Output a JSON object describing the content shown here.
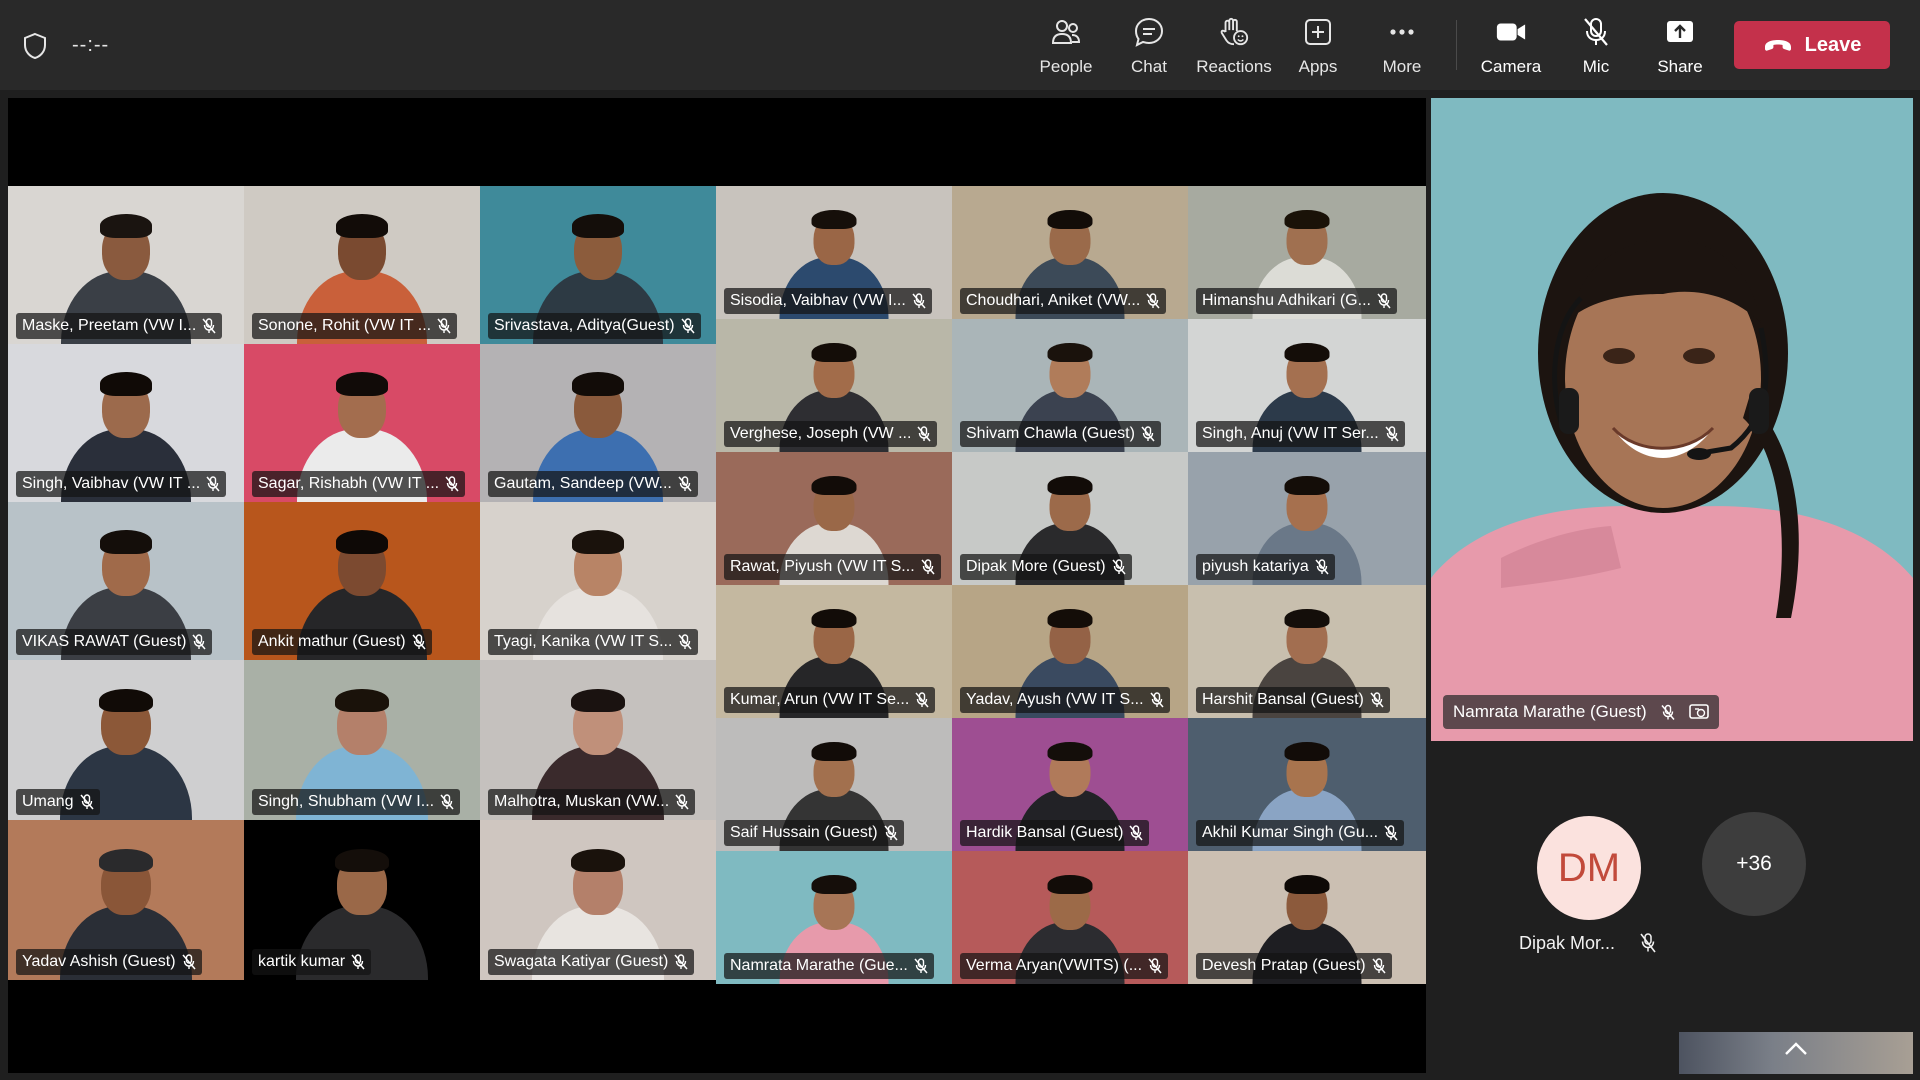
{
  "topbar": {
    "timer": "--:--",
    "buttons": [
      {
        "label": "People",
        "icon": "people-icon"
      },
      {
        "label": "Chat",
        "icon": "chat-icon"
      },
      {
        "label": "Reactions",
        "icon": "reactions-icon"
      },
      {
        "label": "Apps",
        "icon": "apps-icon"
      },
      {
        "label": "More",
        "icon": "more-icon"
      },
      {
        "label": "Camera",
        "icon": "camera-icon"
      },
      {
        "label": "Mic",
        "icon": "mic-off-icon"
      },
      {
        "label": "Share",
        "icon": "share-icon"
      }
    ],
    "leave_label": "Leave",
    "leave_color": "#c4314b"
  },
  "grid": {
    "participants": [
      {
        "name": "Maske, Preetam (VW I...",
        "bg": "#d9d6d2",
        "skin": "#8a5a3e",
        "shirt": "#3a3f46",
        "hair": "#1a1410"
      },
      {
        "name": "Sonone, Rohit (VW IT ...",
        "bg": "#cfcac3",
        "skin": "#7a4a30",
        "shirt": "#c9603a",
        "hair": "#120c08"
      },
      {
        "name": "Srivastava, Aditya(Guest)",
        "bg": "#3f8a9a",
        "skin": "#8c5c3c",
        "shirt": "#2d3a44",
        "hair": "#140e0a"
      },
      {
        "name": "Sisodia, Vaibhav (VW I...",
        "bg": "#c8c3bd",
        "skin": "#9a6646",
        "shirt": "#2c4a6e",
        "hair": "#160f0a"
      },
      {
        "name": "Choudhari, Aniket (VW...",
        "bg": "#b8a990",
        "skin": "#9a6a4a",
        "shirt": "#3c4a58",
        "hair": "#120c08"
      },
      {
        "name": "Himanshu Adhikari (G...",
        "bg": "#a7aaa0",
        "skin": "#a07050",
        "shirt": "#dcdcd6",
        "hair": "#1a1208"
      },
      {
        "name": "Singh, Vaibhav (VW IT ...",
        "bg": "#d8d9dd",
        "skin": "#9c6a4c",
        "shirt": "#2a2f3a",
        "hair": "#100a06"
      },
      {
        "name": "Sagar, Rishabh (VW IT ...",
        "bg": "#d84a66",
        "skin": "#a36d4e",
        "shirt": "#ebebeb",
        "hair": "#110b08"
      },
      {
        "name": "Gautam, Sandeep (VW...",
        "bg": "#b4b2b4",
        "skin": "#8a5a3c",
        "shirt": "#3d6fb0",
        "hair": "#120c08"
      },
      {
        "name": "Verghese, Joseph (VW ...",
        "bg": "#b9b7a8",
        "skin": "#a26c4a",
        "shirt": "#2e2e32",
        "hair": "#140d08"
      },
      {
        "name": "Shivam Chawla (Guest)",
        "bg": "#aab5b8",
        "skin": "#b07c5a",
        "shirt": "#3b4250",
        "hair": "#1a120c"
      },
      {
        "name": "Singh, Anuj (VW IT Ser...",
        "bg": "#d3d5d4",
        "skin": "#a47050",
        "shirt": "#2c3a4a",
        "hair": "#140d08"
      },
      {
        "name": "VIKAS RAWAT (Guest)",
        "bg": "#b8c2c8",
        "skin": "#a06a4a",
        "shirt": "#3b3e44",
        "hair": "#140e0a"
      },
      {
        "name": "Ankit mathur (Guest)",
        "bg": "#b8561c",
        "skin": "#7c4a30",
        "shirt": "#262628",
        "hair": "#0e0906"
      },
      {
        "name": "Tyagi, Kanika (VW IT S...",
        "bg": "#d7d2cc",
        "skin": "#b88466",
        "shirt": "#e6e2de",
        "hair": "#1a120c"
      },
      {
        "name": "Rawat, Piyush (VW IT S...",
        "bg": "#9a6a5a",
        "skin": "#9a6848",
        "shirt": "#ddd8d2",
        "hair": "#120c08"
      },
      {
        "name": "Dipak More (Guest)",
        "bg": "#c7c9c7",
        "skin": "#9c6a4a",
        "shirt": "#2a2a2c",
        "hair": "#120c08"
      },
      {
        "name": "piyush katariya",
        "bg": "#98a2ab",
        "skin": "#a6704e",
        "shirt": "#6a7888",
        "hair": "#140d08"
      },
      {
        "name": "Umang",
        "bg": "#cfcfd0",
        "skin": "#8c5838",
        "shirt": "#2c3644",
        "hair": "#110b07"
      },
      {
        "name": "Singh, Shubham (VW I...",
        "bg": "#a9b0a6",
        "skin": "#b4806a",
        "shirt": "#7fb4d4",
        "hair": "#1a120a"
      },
      {
        "name": "Malhotra, Muskan (VW...",
        "bg": "#c5c1be",
        "skin": "#c0907a",
        "shirt": "#3a2a2c",
        "hair": "#1a1210"
      },
      {
        "name": "Kumar, Arun (VW IT Se...",
        "bg": "#c4b8a0",
        "skin": "#9a6646",
        "shirt": "#262628",
        "hair": "#120c08"
      },
      {
        "name": "Yadav, Ayush (VW IT S...",
        "bg": "#b7a586",
        "skin": "#946246",
        "shirt": "#3a4a60",
        "hair": "#140d08"
      },
      {
        "name": "Harshit Bansal (Guest)",
        "bg": "#c8bfae",
        "skin": "#a26e50",
        "shirt": "#4a4440",
        "hair": "#140e0a"
      },
      {
        "name": "Saif Hussain (Guest)",
        "bg": "#bdbcbb",
        "skin": "#a2704e",
        "shirt": "#343434",
        "hair": "#120c08"
      },
      {
        "name": "Hardik Bansal  (Guest)",
        "bg": "#9e4e92",
        "skin": "#b07a5a",
        "shirt": "#222226",
        "hair": "#140e0a"
      },
      {
        "name": "Akhil Kumar Singh (Gu...",
        "bg": "#4e5e6e",
        "skin": "#a8744e",
        "shirt": "#8aa4c4",
        "hair": "#120c08"
      },
      {
        "name": "Yadav Ashish  (Guest)",
        "bg": "#b37a5a",
        "skin": "#8a5638",
        "shirt": "#2a2e36",
        "hair": "#2a2a2c"
      },
      {
        "name": "kartik kumar",
        "bg": "#000000",
        "skin": "#9a6848",
        "shirt": "#2a2a2c",
        "hair": "#140e0a"
      },
      {
        "name": "Swagata Katiyar (Guest)",
        "bg": "#cfc6c0",
        "skin": "#b4806a",
        "shirt": "#e8e4e0",
        "hair": "#1a120c"
      },
      {
        "name": "Namrata Marathe (Gue...",
        "bg": "#7fbac1",
        "skin": "#a77556",
        "shirt": "#e79aab",
        "hair": "#150e0a"
      },
      {
        "name": "Verma Aryan(VWITS) (...",
        "bg": "#b65a5a",
        "skin": "#9c6a48",
        "shirt": "#2c2c30",
        "hair": "#120c08"
      },
      {
        "name": "Devesh Pratap (Guest)",
        "bg": "#cbbfb2",
        "skin": "#8c5a3c",
        "shirt": "#1e1e22",
        "hair": "#0e0906"
      }
    ]
  },
  "spotlight": {
    "name": "Namrata Marathe (Guest)",
    "bg": "#7fbac1"
  },
  "side": {
    "avatar_initials": "DM",
    "avatar_name": "Dipak Mor...",
    "overflow_count": "+36"
  }
}
